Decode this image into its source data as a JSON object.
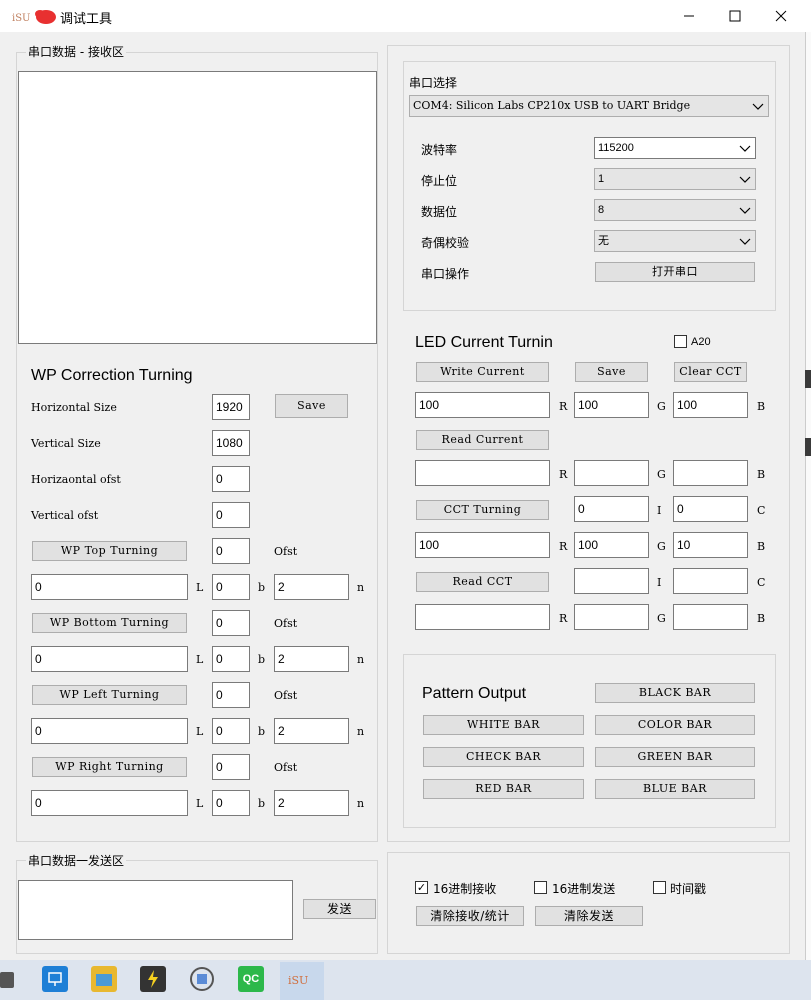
{
  "window": {
    "title": "调试工具",
    "minimize_icon": "minimize-icon",
    "maximize_icon": "maximize-icon",
    "close_icon": "close-icon"
  },
  "receive": {
    "group_label": "串口数据 - 接收区",
    "text": ""
  },
  "wp": {
    "heading": "WP Correction Turning",
    "horizontal_size_label": "Horizontal Size",
    "horizontal_size": "1920",
    "vertical_size_label": "Vertical Size",
    "vertical_size": "1080",
    "horizontal_ofst_label": "Horizaontal ofst",
    "horizontal_ofst": "0",
    "vertical_ofst_label": "Vertical ofst",
    "vertical_ofst": "0",
    "save_label": "Save",
    "ofst_label": "Ofst",
    "l_label": "L",
    "b_label": "b",
    "n_label": "n",
    "rows": [
      {
        "button": "WP Top Turning",
        "ofst": "0",
        "l": "0",
        "b": "0",
        "n": "2"
      },
      {
        "button": "WP Bottom Turning",
        "ofst": "0",
        "l": "0",
        "b": "0",
        "n": "2"
      },
      {
        "button": "WP Left Turning",
        "ofst": "0",
        "l": "0",
        "b": "0",
        "n": "2"
      },
      {
        "button": "WP Right Turning",
        "ofst": "0",
        "l": "0",
        "b": "0",
        "n": "2"
      }
    ]
  },
  "send": {
    "group_label": "串口数据一发送区",
    "text": "",
    "send_label": "发送"
  },
  "serial": {
    "heading": "串口选择",
    "port": "COM4: Silicon Labs CP210x USB to UART Bridge",
    "baud_label": "波特率",
    "baud": "115200",
    "stop_label": "停止位",
    "stop": "1",
    "data_label": "数据位",
    "data": "8",
    "parity_label": "奇偶校验",
    "parity": "无",
    "op_label": "串口操作",
    "open_label": "打开串口"
  },
  "led": {
    "heading": "LED Current Turning",
    "a20_label": "A20",
    "write_current": "Write Current",
    "save": "Save",
    "clear_cct": "Clear CCT",
    "write_r": "100",
    "write_g": "100",
    "write_b": "100",
    "read_current": "Read Current",
    "read_r": "",
    "read_g": "",
    "read_b": "",
    "cct_turning": "CCT Turning",
    "cct_i": "0",
    "cct_c": "0",
    "cct_r_out": "100",
    "cct_g_out": "100",
    "cct_b_out": "10",
    "read_cct": "Read CCT",
    "read_cct_i": "",
    "read_cct_c": "",
    "last_r": "",
    "last_g": "",
    "last_b": "",
    "r": "R",
    "g": "G",
    "b": "B",
    "i": "I",
    "c": "C"
  },
  "pattern": {
    "heading": "Pattern Output",
    "black": "BLACK BAR",
    "white": "WHITE BAR",
    "color": "COLOR BAR",
    "check": "CHECK BAR",
    "green": "GREEN BAR",
    "red": "RED BAR",
    "blue": "BLUE BAR"
  },
  "bottom": {
    "hex_recv": "16进制接收",
    "hex_send": "16进制发送",
    "timestamp": "时间戳",
    "clear_recv": "清除接收/统计",
    "clear_send": "清除发送"
  },
  "taskbar": {
    "icons": [
      "network-icon",
      "folder-icon",
      "app-icon",
      "cube-icon",
      "qc-icon",
      "tool-icon"
    ],
    "qc_text": "QC"
  }
}
